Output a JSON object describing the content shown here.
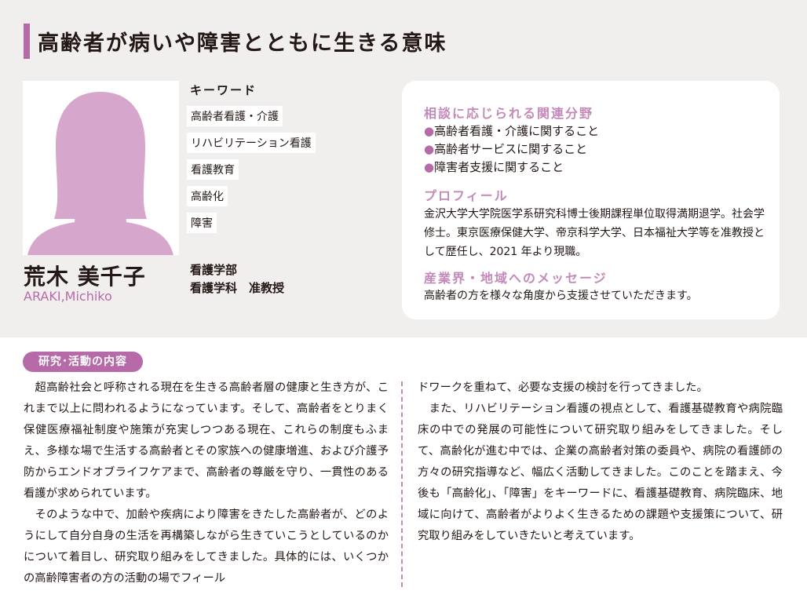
{
  "title": "高齢者が病いや障害とともに生きる意味",
  "profile_person": {
    "name_jp": "荒木 美千子",
    "name_en": "ARAKI,Michiko",
    "department": "看護学部",
    "position": "看護学科　准教授"
  },
  "keywords": {
    "heading": "キーワード",
    "items": [
      "高齢者看護・介護",
      "リハビリテーション看護",
      "看護教育",
      "高齢化",
      "障害"
    ]
  },
  "consult": {
    "heading": "相談に応じられる関連分野",
    "items": [
      "高齢者看護・介護に関すること",
      "高齢者サービスに関すること",
      "障害者支援に関すること"
    ],
    "bullet": "●"
  },
  "profile": {
    "heading": "プロフィール",
    "text": "金沢大学大学院医学系研究科博士後期課程単位取得満期退学。社会学修士。東京医療保健大学、帝京科学大学、日本福祉大学等を准教授として歴任し、2021 年より現職。"
  },
  "message": {
    "heading": "産業界・地域へのメッセージ",
    "text": "高齢者の方を様々な角度から支援させていただきます。"
  },
  "research": {
    "label": "研究･活動の内容",
    "left_paragraphs": [
      "　超高齢社会と呼称される現在を生きる高齢者層の健康と生き方が、これまで以上に問われるようになっています。そして、高齢者をとりまく保健医療福祉制度や施策が充実しつつある現在、これらの制度もふまえ、多様な場で生活する高齢者とその家族への健康増進、および介護予防からエンドオブライフケアまで、高齢者の尊厳を守り、一貫性のある看護が求められています。",
      "　そのような中で、加齢や疾病により障害をきたした高齢者が、どのようにして自分自身の生活を再構築しながら生きていこうとしているのかについて着目し、研究取り組みをしてきました。具体的には、いくつかの高齢障害者の方の活動の場でフィール"
    ],
    "right_paragraphs": [
      "ドワークを重ねて、必要な支援の検討を行ってきました。",
      "　また、リハビリテーション看護の視点として、看護基礎教育や病院臨床の中での発展の可能性について研究取り組みをしてきました。そして、高齢化が進む中では、企業の高齢者対策の委員や、病院の看護師の方々の研究指導など、幅広く活動してきました。このことを踏まえ、今後も「高齢化」、「障害」をキーワードに、看護基礎教育、病院臨床、地域に向けて、高齢者がよりよく生きるための課題や支援策について、研究取り組みをしていきたいと考えています。"
    ]
  },
  "colors": {
    "accent": "#b66ba8",
    "accent_light": "#c38ab9",
    "silhouette": "#d7a6cc",
    "header_bg": "#f1efed"
  },
  "icons": {
    "photo": "person-silhouette-icon"
  }
}
